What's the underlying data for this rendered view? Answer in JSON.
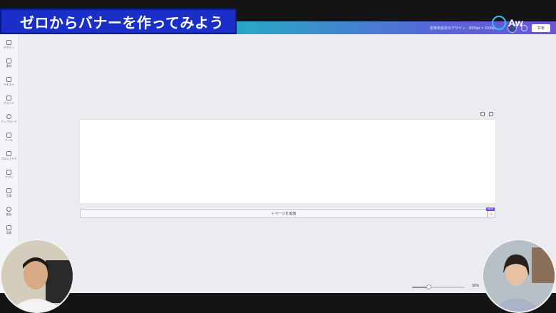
{
  "overlay": {
    "title": "ゼロからバナーを作ってみよう",
    "logo_text": "Aw",
    "logo_icon": "circle-logo-icon"
  },
  "header": {
    "doc_title": "名称未設定のデザイン - 3000px × 1000px",
    "share_label": "共有",
    "icons": [
      "avatar",
      "chart-icon"
    ],
    "gradient_colors": [
      "#1f7fbf",
      "#2aa6c6",
      "#5a63d8",
      "#6a55d6"
    ]
  },
  "sidebar": {
    "items": [
      {
        "label": "デザイン",
        "icon": "layout-icon"
      },
      {
        "label": "素材",
        "icon": "shapes-icon"
      },
      {
        "label": "テキスト",
        "icon": "text-icon"
      },
      {
        "label": "ブランド",
        "icon": "brand-icon"
      },
      {
        "label": "アップロード",
        "icon": "upload-cloud-icon"
      },
      {
        "label": "ツール",
        "icon": "pen-tool-icon"
      },
      {
        "label": "プロジェクト",
        "icon": "folder-icon"
      },
      {
        "label": "アプリ",
        "icon": "apps-grid-icon"
      },
      {
        "label": "写真",
        "icon": "photo-icon"
      },
      {
        "label": "動画",
        "icon": "video-play-icon"
      },
      {
        "label": "背景",
        "icon": "background-icon"
      }
    ]
  },
  "canvas": {
    "tools": [
      "duplicate-page-icon",
      "add-page-icon"
    ],
    "add_page_label": "+ ページを追加",
    "new_badge": "NEW",
    "dropdown_glyph": "⌄"
  },
  "zoom": {
    "value_label": "32%",
    "value": 32
  },
  "webcams": [
    {
      "name": "presenter-left"
    },
    {
      "name": "presenter-right"
    }
  ]
}
